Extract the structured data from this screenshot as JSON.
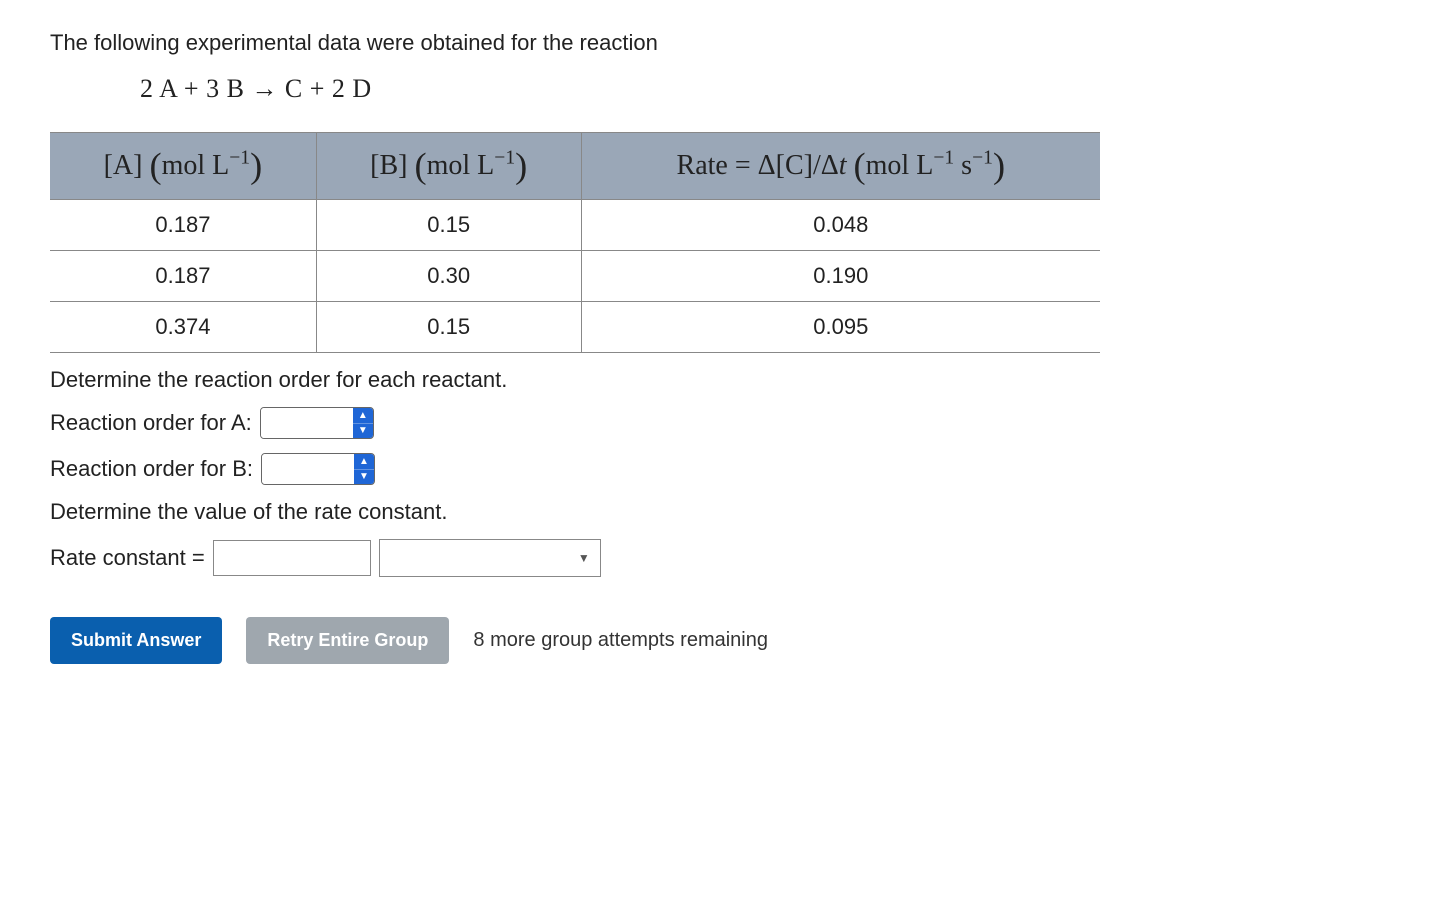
{
  "intro": "The following experimental data were obtained for the reaction",
  "equation_html": "2 A + 3 B → C + 2 D",
  "table": {
    "headers": {
      "a": "[A] (mol L⁻¹)",
      "b": "[B] (mol L⁻¹)",
      "rate": "Rate = Δ[C]/Δt (mol L⁻¹ s⁻¹)"
    },
    "rows": [
      {
        "a": "0.187",
        "b": "0.15",
        "rate": "0.048"
      },
      {
        "a": "0.187",
        "b": "0.30",
        "rate": "0.190"
      },
      {
        "a": "0.374",
        "b": "0.15",
        "rate": "0.095"
      }
    ]
  },
  "prompt_orders": "Determine the reaction order for each reactant.",
  "label_order_a": "Reaction order for A:",
  "label_order_b": "Reaction order for B:",
  "prompt_rate_constant": "Determine the value of the rate constant.",
  "label_rate_constant": "Rate constant =",
  "buttons": {
    "submit": "Submit Answer",
    "retry": "Retry Entire Group"
  },
  "attempts_text": "8 more group attempts remaining",
  "chart_data": {
    "type": "table",
    "title": "Initial-rate data for 2A + 3B → C + 2D",
    "columns": [
      "[A] (mol/L)",
      "[B] (mol/L)",
      "Rate Δ[C]/Δt (mol L⁻¹ s⁻¹)"
    ],
    "rows": [
      [
        0.187,
        0.15,
        0.048
      ],
      [
        0.187,
        0.3,
        0.19
      ],
      [
        0.374,
        0.15,
        0.095
      ]
    ]
  }
}
